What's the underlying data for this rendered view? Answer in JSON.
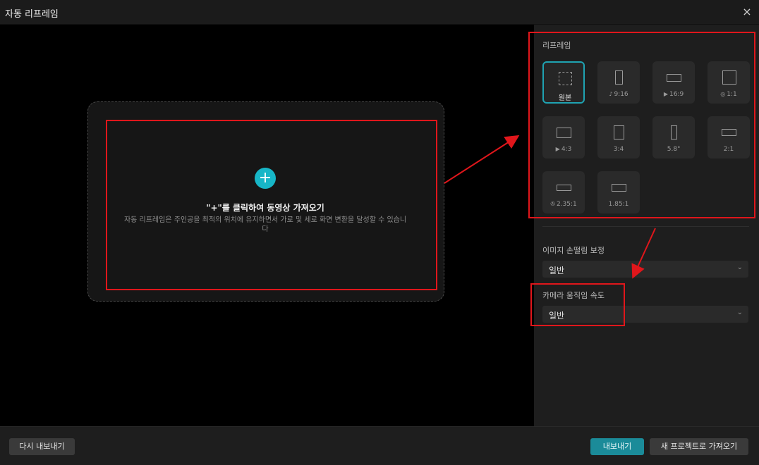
{
  "window": {
    "title": "자동 리프레임",
    "close_icon": "×"
  },
  "dropzone": {
    "plus": "+",
    "title": "\"+\"를 클릭하여 동영상 가져오기",
    "description": "자동 리프레임은 주인공을 최적의 위치에 유지하면서 가로 및 세로 화면 변환을 달성할 수 있습니다"
  },
  "panel": {
    "reframe_label": "리프레임",
    "ratios": [
      {
        "label": "원본",
        "icon": "",
        "selected": true
      },
      {
        "label": "9:16",
        "icon": "tiktok-icon"
      },
      {
        "label": "16:9",
        "icon": "youtube-icon"
      },
      {
        "label": "1:1",
        "icon": "instagram-icon"
      },
      {
        "label": "4:3",
        "icon": "youtube-icon"
      },
      {
        "label": "3:4",
        "icon": ""
      },
      {
        "label": "5.8\"",
        "icon": ""
      },
      {
        "label": "2:1",
        "icon": ""
      },
      {
        "label": "2.35:1",
        "icon": "film-reel-icon"
      },
      {
        "label": "1.85:1",
        "icon": ""
      }
    ],
    "stabilization_label": "이미지 손떨림 보정",
    "stabilization_value": "일반",
    "camera_speed_label": "카메라 움직임 속도",
    "camera_speed_value": "일반"
  },
  "footer": {
    "re_export": "다시 내보내기",
    "export": "내보내기",
    "import_new_project": "새 프로젝트로 가져오기"
  },
  "colors": {
    "accent": "#17b6c7",
    "annotation_red": "#e0161b",
    "selected_border": "#1fa3b2"
  }
}
